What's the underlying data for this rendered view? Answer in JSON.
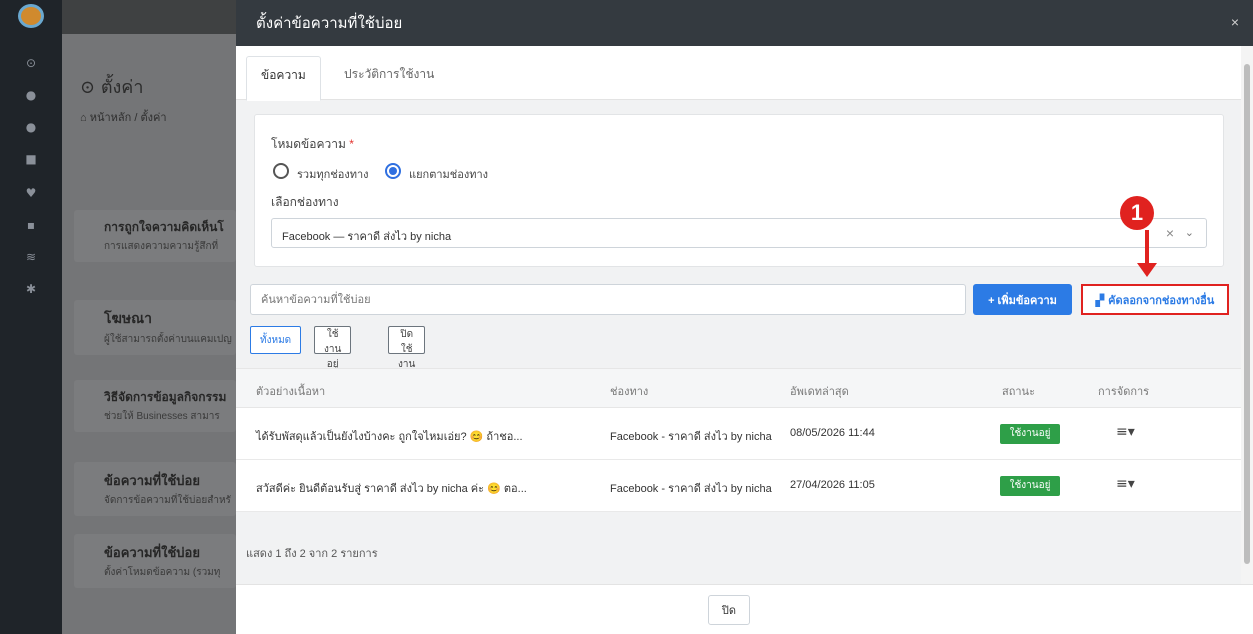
{
  "background": {
    "page_title": "ตั้งค่า",
    "breadcrumb": "หน้าหลัก / ตั้งค่า",
    "cards": [
      {
        "title": "การถูกใจความคิดเห็นโ",
        "subtitle": "การแสดงความความรู้สึกที่"
      },
      {
        "title": "โฆษณา",
        "subtitle": "ผู้ใช้สามารถตั้งค่าบนแคมเปญ"
      },
      {
        "title": "วิธีจัดการข้อมูลกิจกรรม",
        "subtitle": "ช่วยให้ Businesses สามาร"
      },
      {
        "title": "ข้อความที่ใช้บ่อย",
        "subtitle": "จัดการข้อความที่ใช้บ่อยสำหรั"
      },
      {
        "title": "ข้อความที่ใช้บ่อย",
        "subtitle": "ตั้งค่าโหมดข้อความ (รวมทุ"
      }
    ]
  },
  "modal": {
    "title": "ตั้งค่าข้อความที่ใช้บ่อย",
    "close_glyph": "×",
    "tabs": [
      "ข้อความ",
      "ประวัติการใช้งาน"
    ],
    "mode_label": "โหมดข้อความ",
    "required_mark": "*",
    "radio_all": "รวมทุกช่องทาง",
    "radio_split": "แยกตามช่องทาง",
    "channel_label": "เลือกช่องทาง",
    "channel_value": "Facebook — ราคาดี ส่งไว by nicha",
    "search_placeholder": "ค้นหาข้อความที่ใช้บ่อย",
    "add_button": "+ เพิ่มข้อความ",
    "copy_button": "คัดลอกจากช่องทางอื่น",
    "filters": [
      "ทั้งหมด",
      "ใช้งานอยู่",
      "ปิดใช้งาน"
    ],
    "table": {
      "headers": [
        "ตัวอย่างเนื้อหา",
        "ช่องทาง",
        "อัพเดทล่าสุด",
        "สถานะ",
        "การจัดการ"
      ],
      "rows": [
        {
          "content": "ได้รับพัสดุแล้วเป็นยังไงบ้างคะ ถูกใจไหมเอ่ย? 😊 ถ้าชอ...",
          "channel": "Facebook - ราคาดี ส่งไว by nicha",
          "updated": "08/05/2026 11:44",
          "status": "ใช้งานอยู่",
          "action": "≡▾"
        },
        {
          "content": "สวัสดีค่ะ ยินดีต้อนรับสู่ ราคาดี ส่งไว by nicha ค่ะ 😊 ตอ...",
          "channel": "Facebook - ราคาดี ส่งไว by nicha",
          "updated": "27/04/2026 11:05",
          "status": "ใช้งานอยู่",
          "action": "≡▾"
        }
      ]
    },
    "summary": "แสดง 1 ถึง 2 จาก 2 รายการ",
    "footer_close": "ปิด"
  },
  "annotation": {
    "number": "1",
    "color": "#e0221f"
  },
  "colors": {
    "primary": "#2c7be5",
    "success": "#2e9f48",
    "header": "#343a40"
  }
}
